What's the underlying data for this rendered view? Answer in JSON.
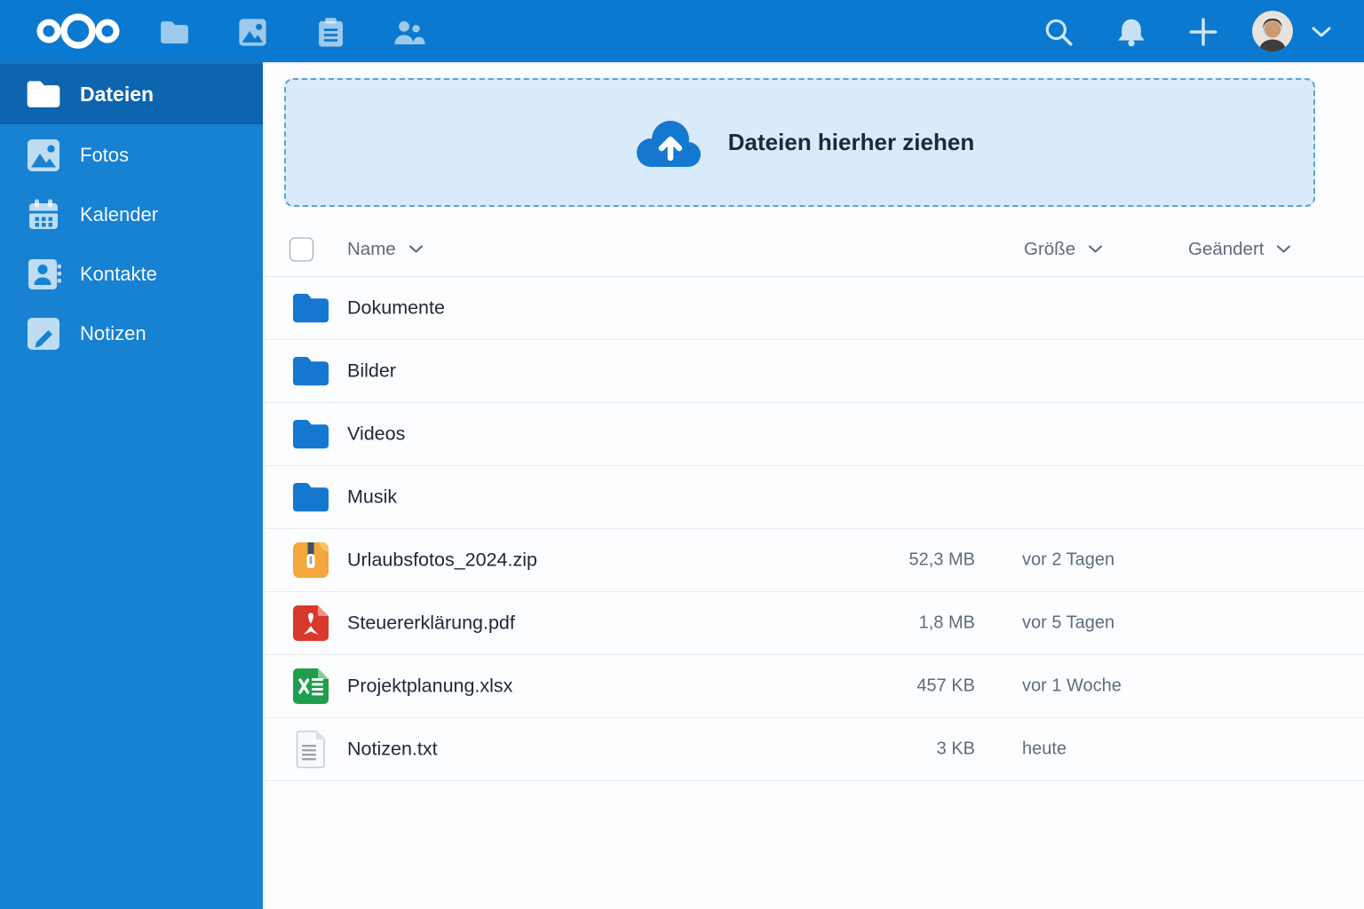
{
  "colors": {
    "accent": "#1478d0",
    "topbar_bg": "#0b79d0",
    "sidebar_bg": "#1781d2",
    "sidebar_active_bg": "#0d64af",
    "dropzone_bg": "#d9eafb",
    "dropzone_border": "#58a4dd",
    "zip_orange": "#f3a73c",
    "pdf_red": "#d8392c",
    "xlsx_green": "#1f9e4d",
    "text_dark": "#1d2838",
    "text_gray": "#5d6c7c"
  },
  "topbar": {
    "logo_icon": "nextcloud-logo",
    "app_icons": [
      "files-folder",
      "photos",
      "tasks-clipboard",
      "contacts-users"
    ],
    "action_icons": [
      "search",
      "notifications-bell",
      "add-plus"
    ],
    "has_avatar": true,
    "avatar_menu_icon": "chevron-down"
  },
  "sidebar": {
    "items": [
      {
        "label": "Dateien",
        "icon": "folder",
        "active": true
      },
      {
        "label": "Fotos",
        "icon": "photos",
        "active": false
      },
      {
        "label": "Kalender",
        "icon": "calendar",
        "active": false
      },
      {
        "label": "Kontakte",
        "icon": "contacts",
        "active": false
      },
      {
        "label": "Notizen",
        "icon": "notes",
        "active": false
      }
    ]
  },
  "upload": {
    "label": "Dateien hierher ziehen",
    "icon": "cloud-upload"
  },
  "files_table": {
    "columns": [
      {
        "label": "Name",
        "sortable": true
      },
      {
        "label": "Größe",
        "sortable": true
      },
      {
        "label": "Geändert",
        "sortable": true
      }
    ],
    "rows": [
      {
        "name": "Dokumente",
        "icon": "folder",
        "size": "",
        "modified": ""
      },
      {
        "name": "Bilder",
        "icon": "folder",
        "size": "",
        "modified": ""
      },
      {
        "name": "Videos",
        "icon": "folder",
        "size": "",
        "modified": ""
      },
      {
        "name": "Musik",
        "icon": "folder",
        "size": "",
        "modified": ""
      },
      {
        "name": "Urlaubsfotos_2024.zip",
        "icon": "zip",
        "size": "52,3 MB",
        "modified": "vor 2 Tagen"
      },
      {
        "name": "Steuererklärung.pdf",
        "icon": "pdf",
        "size": "1,8 MB",
        "modified": "vor 5 Tagen"
      },
      {
        "name": "Projektplanung.xlsx",
        "icon": "xlsx",
        "size": "457 KB",
        "modified": "vor 1 Woche"
      },
      {
        "name": "Notizen.txt",
        "icon": "txt",
        "size": "3 KB",
        "modified": "heute"
      }
    ]
  }
}
